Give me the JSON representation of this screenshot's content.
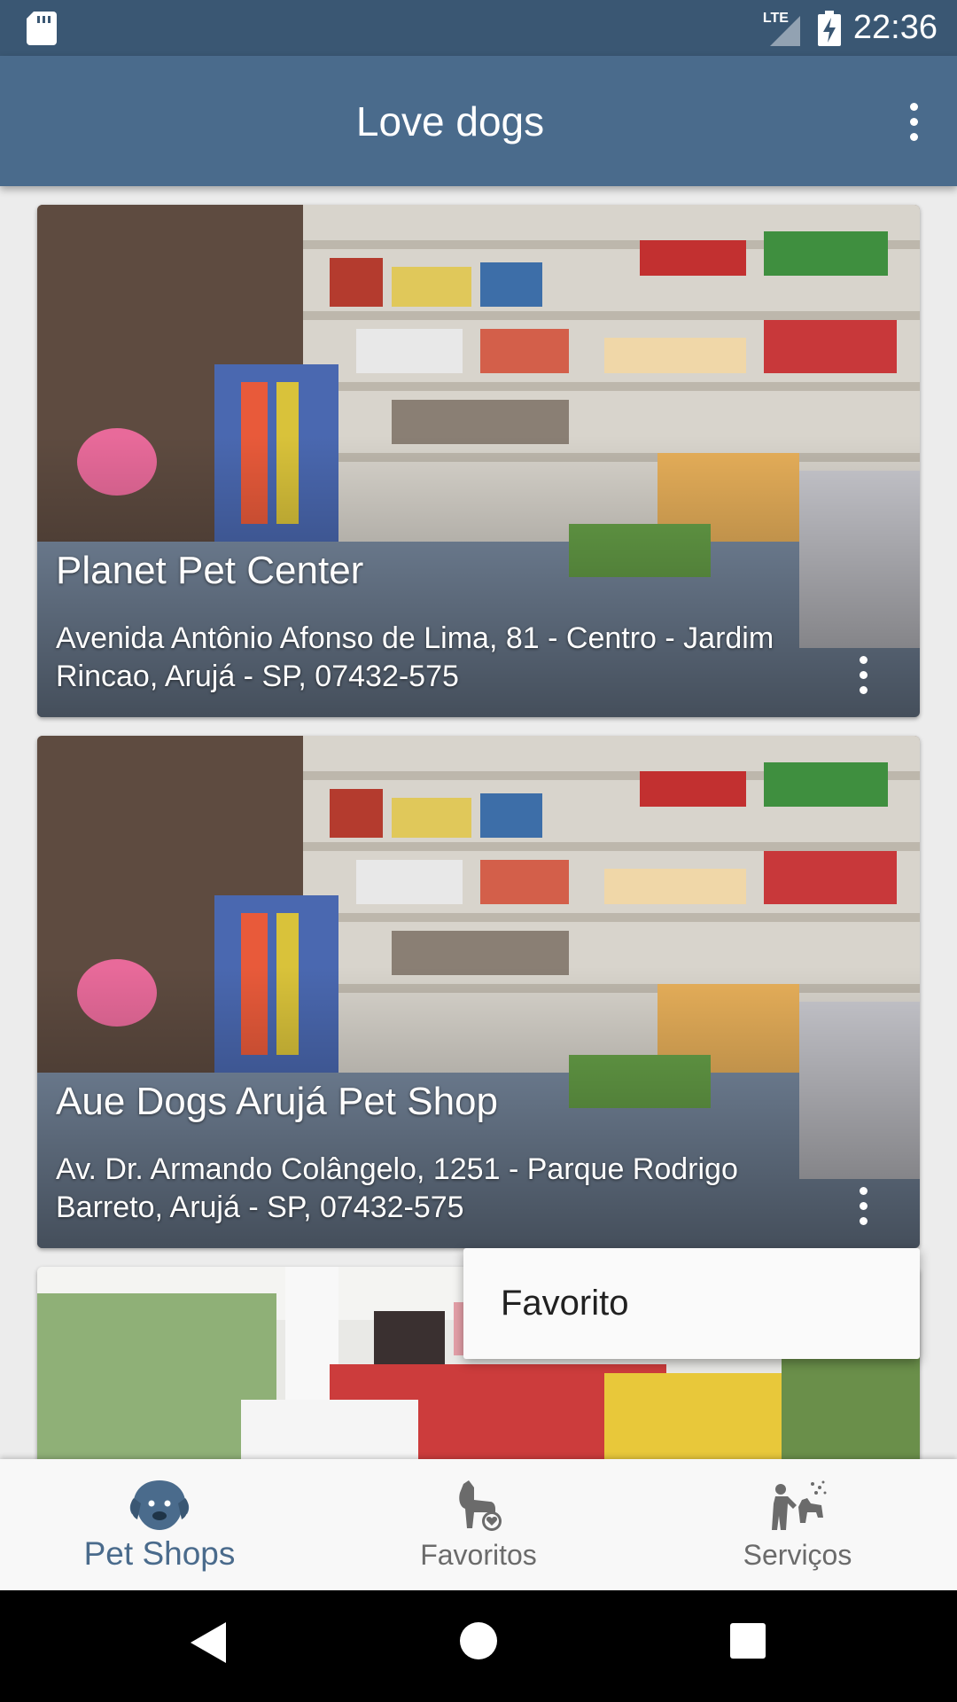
{
  "status_bar": {
    "time": "22:36",
    "network": "LTE",
    "icons": [
      "sd-card-icon",
      "signal-icon",
      "battery-charging-icon"
    ]
  },
  "app_bar": {
    "title": "Love dogs",
    "menu_icon": "more-vert-icon"
  },
  "cards": [
    {
      "title": "Planet Pet Center",
      "address": "Avenida Antônio Afonso de Lima, 81 - Centro - Jardim Rincao, Arujá - SP, 07432-575",
      "menu_icon": "more-vert-icon"
    },
    {
      "title": "Aue Dogs Arujá Pet Shop",
      "address": "Av. Dr. Armando Colângelo, 1251 - Parque Rodrigo Barreto, Arujá - SP, 07432-575",
      "menu_icon": "more-vert-icon"
    },
    {
      "title": "",
      "address": "",
      "menu_icon": ""
    }
  ],
  "popup_menu": {
    "items": [
      "Favorito"
    ]
  },
  "bottom_nav": {
    "items": [
      {
        "label": "Pet Shops",
        "icon": "dog-face-icon",
        "active": true
      },
      {
        "label": "Favoritos",
        "icon": "dog-heart-icon",
        "active": false
      },
      {
        "label": "Serviços",
        "icon": "dog-grooming-icon",
        "active": false
      }
    ],
    "active_color": "#4a6b8c",
    "inactive_color": "#6b6b6b"
  },
  "system_nav": {
    "icons": [
      "back-icon",
      "home-icon",
      "recents-icon"
    ]
  },
  "colors": {
    "status_bar": "#3a5773",
    "app_bar": "#4a6b8c"
  }
}
